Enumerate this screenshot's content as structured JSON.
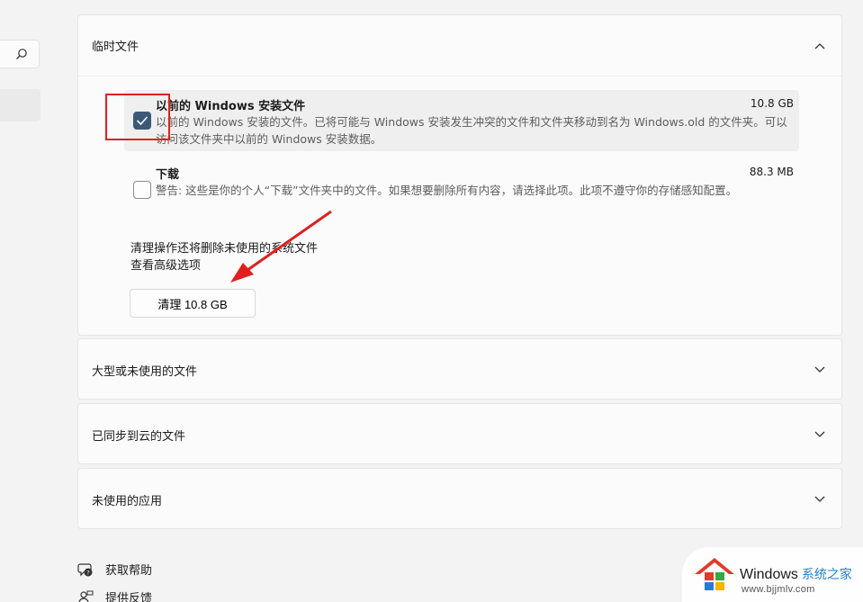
{
  "temp_files": {
    "title": "临时文件",
    "items": [
      {
        "title": "以前的 Windows 安装文件",
        "size": "10.8 GB",
        "desc": "以前的 Windows 安装的文件。已将可能与 Windows 安装发生冲突的文件和文件夹移动到名为 Windows.old 的文件夹。可以访问该文件夹中以前的 Windows 安装数据。",
        "checked": true
      },
      {
        "title": "下载",
        "size": "88.3 MB",
        "desc": "警告: 这些是你的个人“下载”文件夹中的文件。如果想要删除所有内容，请选择此项。此项不遵守你的存储感知配置。",
        "checked": false
      }
    ],
    "note": "清理操作还将删除未使用的系统文件",
    "advanced_link": "查看高级选项",
    "clean_button": "清理 10.8 GB"
  },
  "sections": [
    {
      "title": "大型或未使用的文件"
    },
    {
      "title": "已同步到云的文件"
    },
    {
      "title": "未使用的应用"
    }
  ],
  "footer": {
    "help": "获取帮助",
    "feedback": "提供反馈"
  },
  "watermark": {
    "brand": "Windows",
    "suffix": "系统之家",
    "url": "www.bjjmlv.com"
  },
  "colors": {
    "accent": "#3c5a78",
    "annotation": "#e02020",
    "background": "#f3f3f3"
  }
}
